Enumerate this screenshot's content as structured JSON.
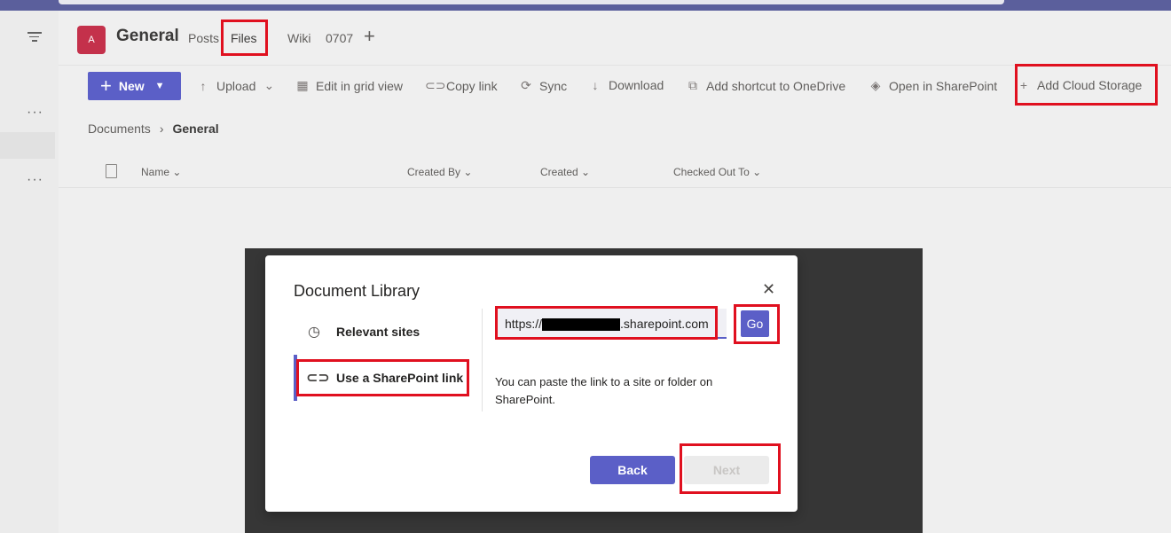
{
  "header": {
    "avatar_letter": "A",
    "channel_title": "General",
    "tabs": [
      {
        "label": "Posts"
      },
      {
        "label": "Files"
      },
      {
        "label": "Wiki"
      },
      {
        "label": "0707"
      }
    ],
    "add_tab_glyph": "+"
  },
  "toolbar": {
    "new_label": "New",
    "items": [
      {
        "label": "Upload",
        "icon": "upload-icon"
      },
      {
        "label": "Edit in grid view",
        "icon": "grid-icon"
      },
      {
        "label": "Copy link",
        "icon": "link-icon"
      },
      {
        "label": "Sync",
        "icon": "sync-icon"
      },
      {
        "label": "Download",
        "icon": "download-icon"
      },
      {
        "label": "Add shortcut to OneDrive",
        "icon": "shortcut-icon"
      },
      {
        "label": "Open in SharePoint",
        "icon": "sharepoint-icon"
      },
      {
        "label": "Add Cloud Storage",
        "icon": "plus-icon"
      }
    ]
  },
  "breadcrumb": {
    "root": "Documents",
    "current": "General"
  },
  "columns": [
    "Name",
    "Created By",
    "Created",
    "Checked Out To"
  ],
  "dialog": {
    "title": "Document Library",
    "nav": [
      {
        "label": "Relevant sites",
        "icon": "clock-icon"
      },
      {
        "label": "Use a SharePoint link",
        "icon": "link-icon"
      }
    ],
    "url_prefix": "https://",
    "url_suffix": ".sharepoint.com",
    "go_label": "Go",
    "hint": "You can paste the link to a site or folder on SharePoint.",
    "back_label": "Back",
    "next_label": "Next"
  },
  "colors": {
    "accent": "#5b5fc7",
    "annotation": "#e0101f"
  }
}
